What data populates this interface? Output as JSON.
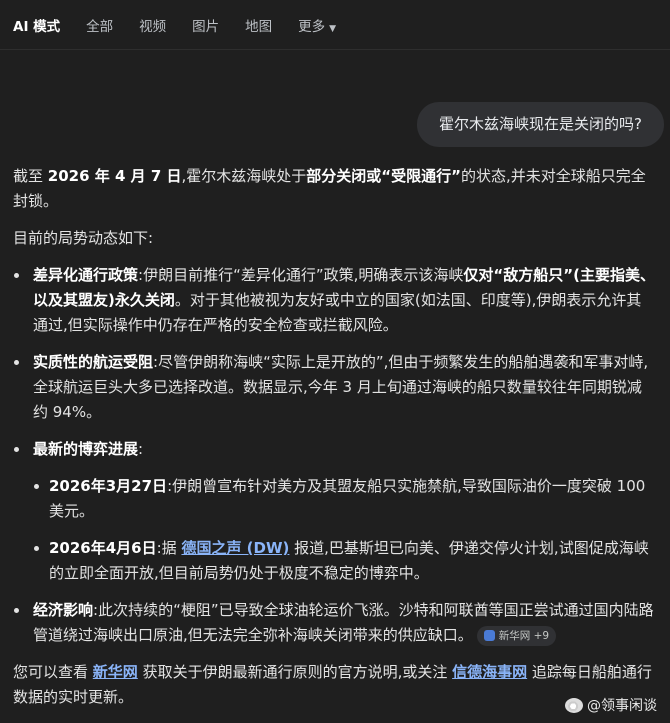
{
  "tabs": [
    {
      "label": "AI 模式",
      "active": true
    },
    {
      "label": "全部"
    },
    {
      "label": "视频"
    },
    {
      "label": "图片"
    },
    {
      "label": "地图"
    },
    {
      "label": "更多"
    }
  ],
  "query": "霍尔木兹海峡现在是关闭的吗?",
  "intro": {
    "t1": "截至 ",
    "b1": "2026 年 4 月 7 日",
    "t2": ",霍尔木兹海峡处于",
    "b2": "部分关闭或“受限通行”",
    "t3": "的状态,并未对全球船只完全封锁。"
  },
  "lead": "目前的局势动态如下:",
  "bullets": {
    "b1": {
      "title": "差异化通行政策",
      "t1": ":伊朗目前推行“差异化通行”政策,明确表示该海峡",
      "b1": "仅对“敌方船只”(主要指美、以及其盟友)永久关闭",
      "t2": "。对于其他被视为友好或中立的国家(如法国、印度等),伊朗表示允许其通过,但实际操作中仍存在严格的安全检查或拦截风险。"
    },
    "b2": {
      "title": "实质性的航运受阻",
      "text": ":尽管伊朗称海峡“实际上是开放的”,但由于频繁发生的船舶遇袭和军事对峙,全球航运巨头大多已选择改道。数据显示,今年 3 月上旬通过海峡的船只数量较往年同期锐减约 94%。"
    },
    "b3": {
      "title": "最新的博弈进展",
      "colon": ":",
      "s1": {
        "date": "2026年3月27日",
        "text": ":伊朗曾宣布针对美方及其盟友船只实施禁航,导致国际油价一度突破 100 美元。"
      },
      "s2": {
        "date": "2026年4月6日",
        "t1": ":据 ",
        "link": "德国之声 (DW)",
        "t2": " 报道,巴基斯坦已向美、伊递交停火计划,试图促成海峡的立即全面开放,但目前局势仍处于极度不稳定的博弈中。"
      }
    },
    "b4": {
      "title": "经济影响",
      "text": ":此次持续的“梗阻”已导致全球油轮运价飞涨。沙特和阿联酋等国正尝试通过国内陆路管道绕过海峡出口原油,但无法完全弥补海峡关闭带来的供应缺口。",
      "chip": "新华网 +9"
    }
  },
  "closing": {
    "t1": "您可以查看 ",
    "link1": "新华网",
    "t2": " 获取关于伊朗最新通行原则的官方说明,或关注 ",
    "link2": "信德海事网",
    "t3": " 追踪每日船舶通行数据的实时更新。"
  },
  "watermark": "@领事闲谈"
}
